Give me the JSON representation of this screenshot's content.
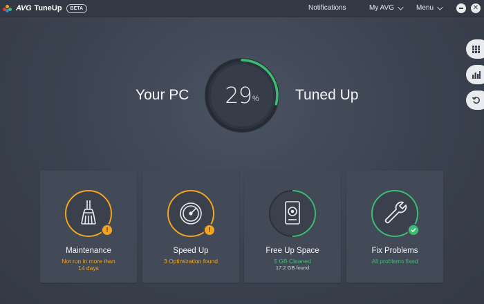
{
  "app": {
    "brand": "AVG",
    "product": "TuneUp",
    "badge": "BETA"
  },
  "nav": {
    "notifications": "Notifications",
    "my_avg": "My AVG",
    "menu": "Menu"
  },
  "hero": {
    "left_text": "Your PC",
    "right_text": "Tuned Up",
    "value": "29",
    "unit": "%",
    "progress": 0.29
  },
  "side_buttons": [
    "grid-icon",
    "bar-chart-icon",
    "restore-icon"
  ],
  "cards": [
    {
      "title": "Maintenance",
      "status_lines": [
        "Not run in more than",
        "14 days"
      ],
      "status_color": "#f2a51d",
      "ring_color": "#f2a51d",
      "icon": "broom-icon",
      "badge": "warning",
      "badge_text": "!"
    },
    {
      "title": "Speed Up",
      "status_lines": [
        "3 Optimization found"
      ],
      "status_color": "#f2a51d",
      "ring_color": "#f2a51d",
      "icon": "speedometer-icon",
      "badge": "warning",
      "badge_text": "!"
    },
    {
      "title": "Free Up Space",
      "status_lines": [
        "5 GB Cleaned"
      ],
      "extra_line": "17.2 GB found",
      "status_color": "#3dbd73",
      "ring_color": "#3dbd73",
      "ring_progress": 0.5,
      "icon": "hard-drive-icon"
    },
    {
      "title": "Fix Problems",
      "status_lines": [
        "All problems fixed"
      ],
      "status_color": "#3dbd73",
      "ring_color": "#3dbd73",
      "icon": "wrench-icon",
      "badge": "ok"
    }
  ],
  "colors": {
    "accent_green": "#3dbd73",
    "accent_orange": "#f2a51d",
    "card_bg": "#434a57"
  }
}
